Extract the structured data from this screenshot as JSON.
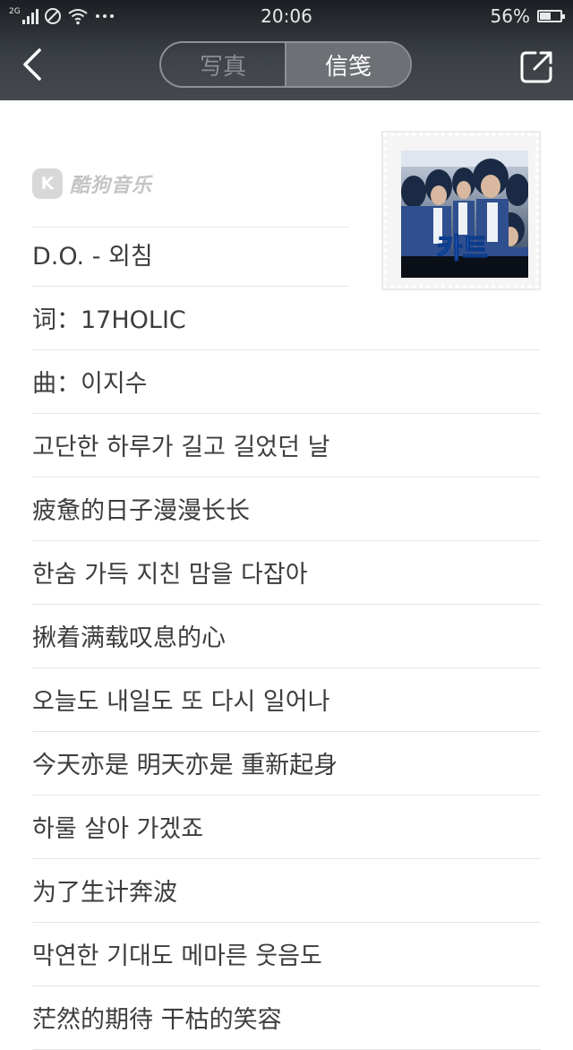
{
  "status_bar": {
    "network": "2G",
    "time": "20:06",
    "battery_percent": "56%",
    "battery_level": 0.56
  },
  "nav": {
    "tabs": [
      {
        "label": "写真",
        "active": false
      },
      {
        "label": "信笺",
        "active": true
      }
    ]
  },
  "brand": {
    "logo_letter": "K",
    "name": "酷狗音乐"
  },
  "album": {
    "cover_title": "카트"
  },
  "lyrics": [
    "D.O. - 외침",
    "词：17HOLIC",
    "曲：이지수",
    "고단한 하루가 길고 길었던 날",
    "疲惫的日子漫漫长长",
    "한숨 가득 지친 맘을 다잡아",
    "揪着满载叹息的心",
    "오늘도 내일도 또 다시 일어나",
    "今天亦是 明天亦是 重新起身",
    "하룰 살아 가겠죠",
    "为了生计奔波",
    "막연한 기대도 메마른 웃음도",
    "茫然的期待 干枯的笑容"
  ],
  "colors": {
    "topbar": "#2b2f33",
    "text": "#3d3d3d",
    "divider": "#e6e6e6",
    "tab_active_bg": "#6d7074"
  }
}
